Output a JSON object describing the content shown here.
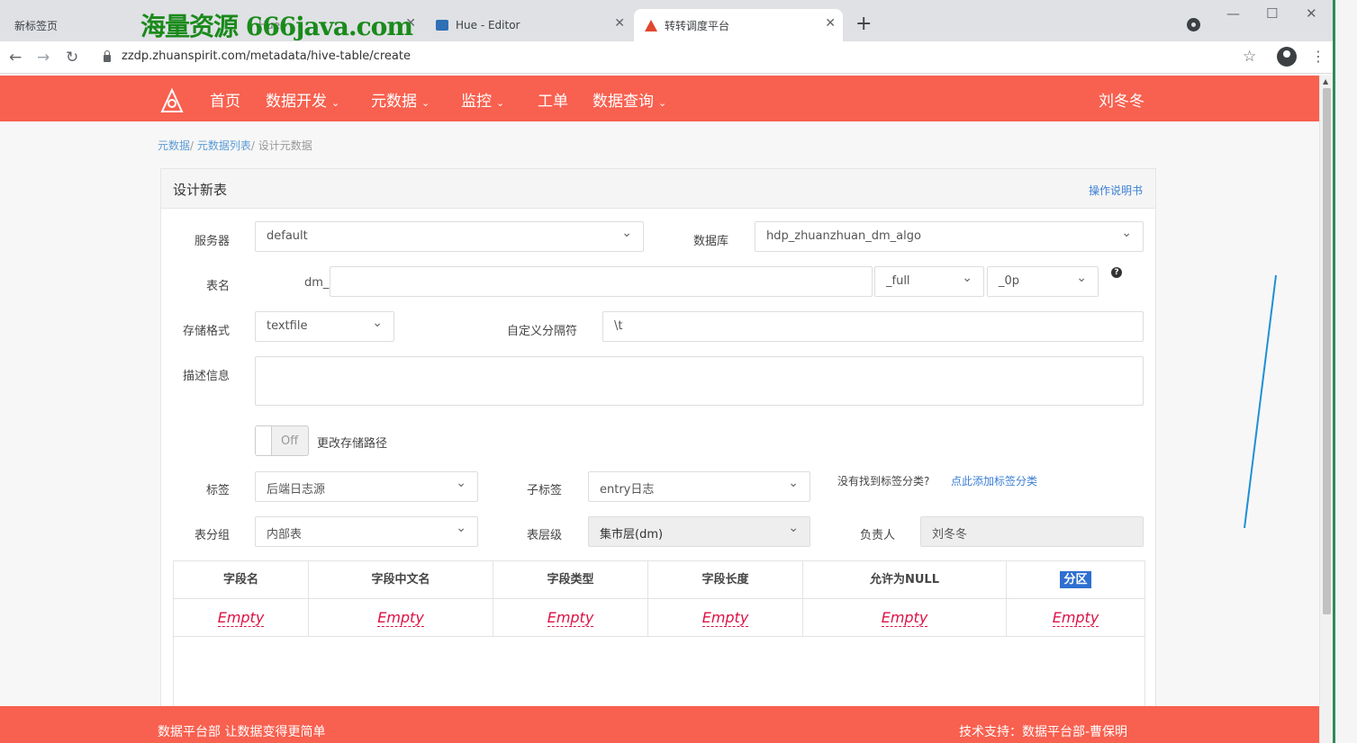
{
  "browser": {
    "tabs": [
      {
        "label": "新标签页"
      },
      {
        "label": "Hue - Editor"
      },
      {
        "label": "转转调度平台"
      }
    ],
    "watermark": "海量资源 666java.com",
    "hidden_tab_fragment": "Hue -",
    "url": "zzdp.zhuanspirit.com/metadata/hive-table/create"
  },
  "nav": {
    "items": [
      {
        "label": "首页",
        "dropdown": false
      },
      {
        "label": "数据开发",
        "dropdown": true
      },
      {
        "label": "元数据",
        "dropdown": true
      },
      {
        "label": "监控",
        "dropdown": true
      },
      {
        "label": "工单",
        "dropdown": false
      },
      {
        "label": "数据查询",
        "dropdown": true
      }
    ],
    "user": "刘冬冬",
    "accent_color": "#f8604f"
  },
  "breadcrumb": {
    "items": [
      "元数据",
      "元数据列表",
      "设计元数据"
    ],
    "separator": "/"
  },
  "panel": {
    "title": "设计新表",
    "help_link": "操作说明书"
  },
  "form": {
    "server_label": "服务器",
    "server_value": "default",
    "database_label": "数据库",
    "database_value": "hdp_zhuanzhuan_dm_algo",
    "table_name_label": "表名",
    "table_prefix": "dm_",
    "table_name_value": "",
    "suffix1_value": "_full",
    "suffix2_value": "_0p",
    "storage_label": "存储格式",
    "storage_value": "textfile",
    "delimiter_label": "自定义分隔符",
    "delimiter_value": "\\t",
    "desc_label": "描述信息",
    "desc_value": "",
    "toggle_state": "Off",
    "toggle_label": "更改存储路径",
    "tag_label": "标签",
    "tag_value": "后端日志源",
    "subtag_label": "子标签",
    "subtag_value": "entry日志",
    "no_tag_text": "没有找到标签分类?",
    "add_tag_link": "点此添加标签分类",
    "group_label": "表分组",
    "group_value": "内部表",
    "level_label": "表层级",
    "level_value": "集市层(dm)",
    "owner_label": "负责人",
    "owner_value": "刘冬冬"
  },
  "table": {
    "headers": [
      "字段名",
      "字段中文名",
      "字段类型",
      "字段长度",
      "允许为NULL",
      "分区"
    ],
    "row": [
      "Empty",
      "Empty",
      "Empty",
      "Empty",
      "Empty",
      "Empty"
    ]
  },
  "footer": {
    "left": "数据平台部 让数据变得更简单",
    "right": "技术支持：数据平台部-曹保明"
  }
}
